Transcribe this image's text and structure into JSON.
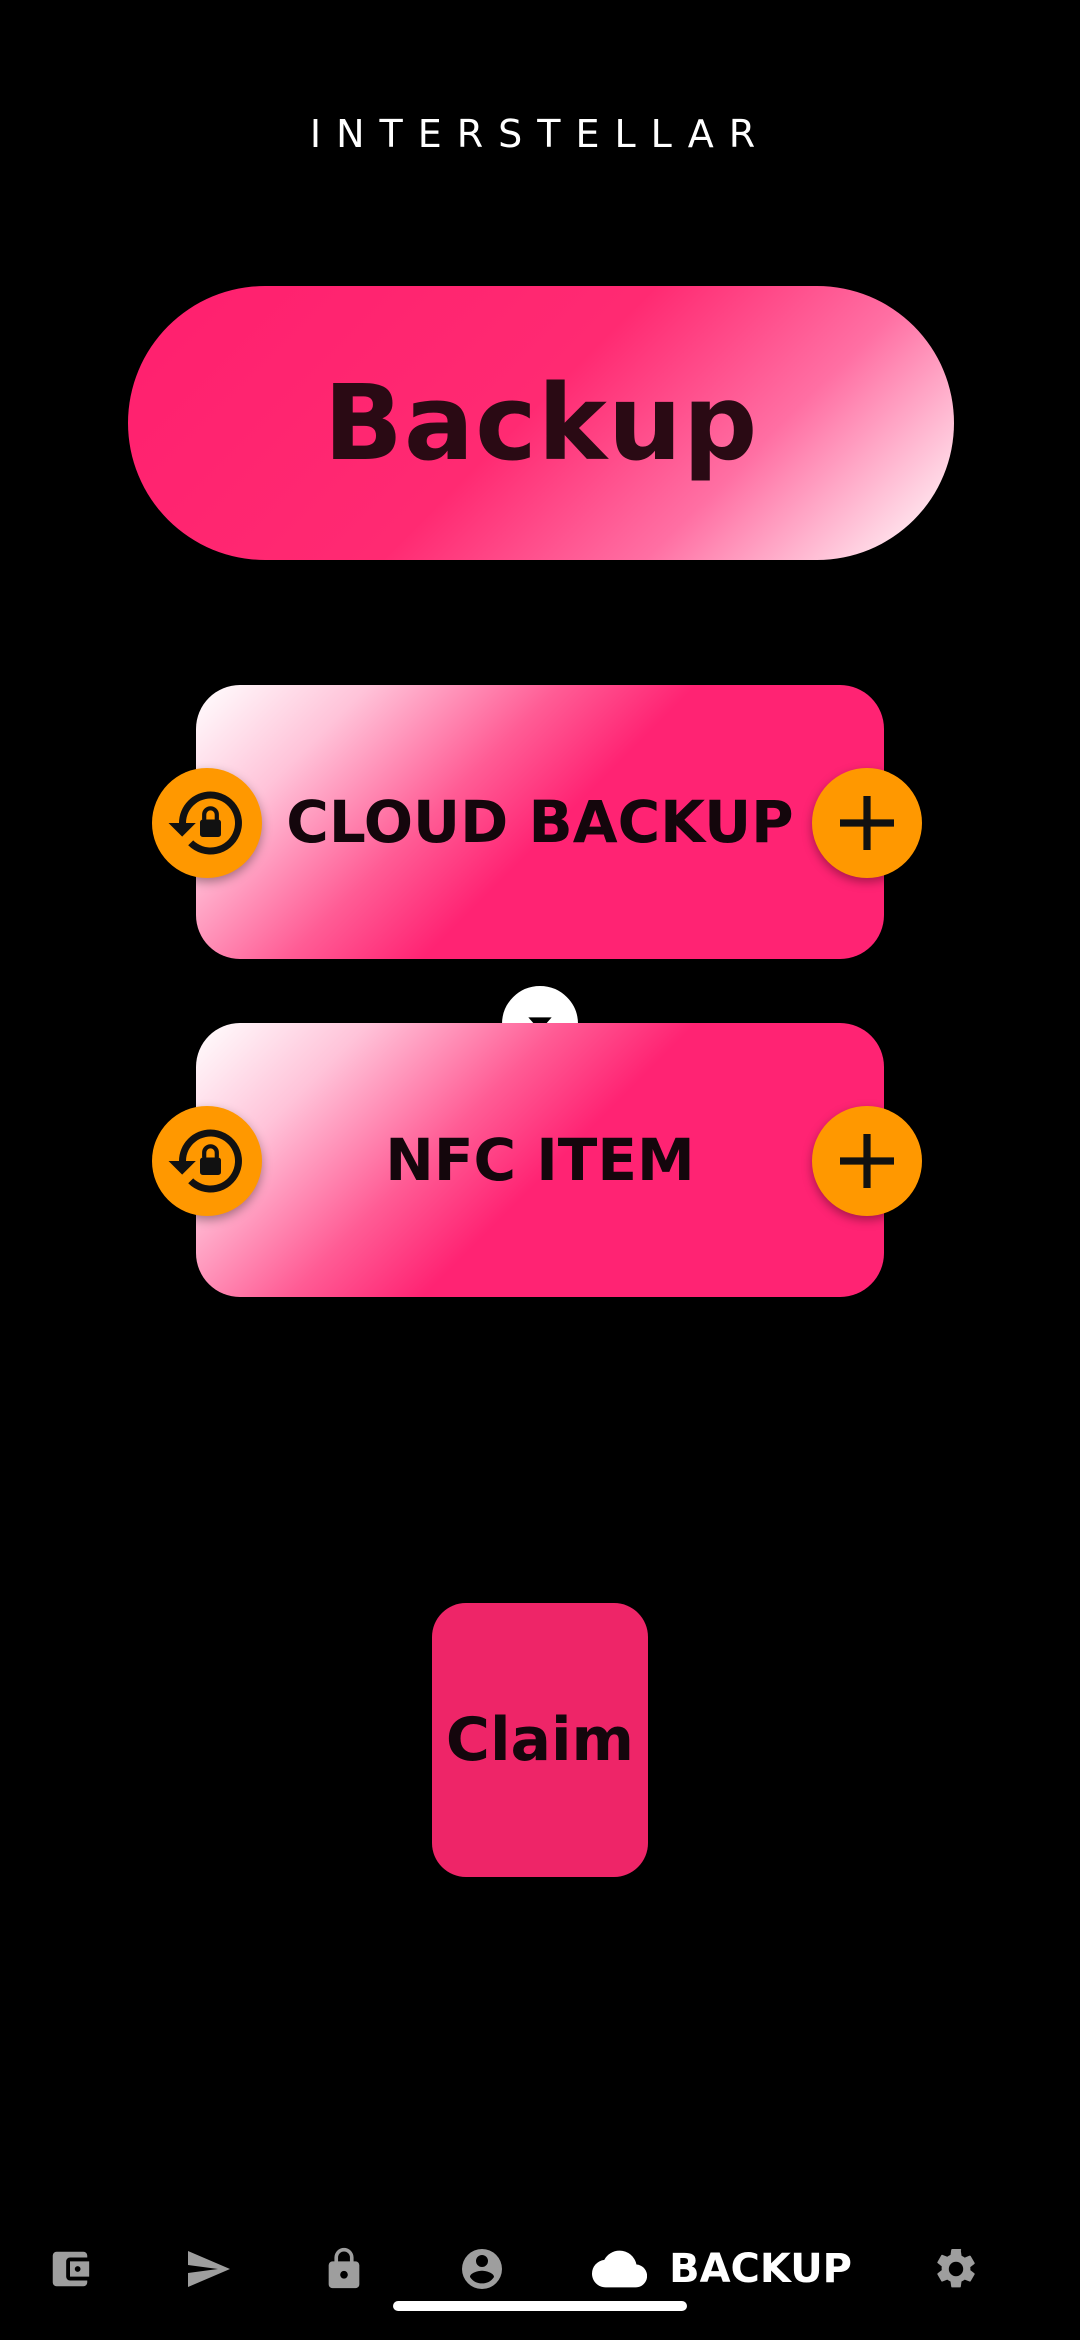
{
  "app": {
    "brand": "INTERSTELLAR"
  },
  "hero": {
    "title": "Backup"
  },
  "cards": {
    "cloud": {
      "label": "CLOUD BACKUP",
      "left_icon": "restore-lock-icon",
      "right_icon": "plus-icon"
    },
    "nfc": {
      "label": "NFC ITEM",
      "left_icon": "restore-lock-icon",
      "right_icon": "plus-icon"
    },
    "connector_icon": "chevron-down-icon"
  },
  "claim": {
    "label": "Claim"
  },
  "nav": {
    "items": [
      {
        "icon": "wallet-icon",
        "label": ""
      },
      {
        "icon": "send-icon",
        "label": ""
      },
      {
        "icon": "lock-icon",
        "label": ""
      },
      {
        "icon": "account-icon",
        "label": ""
      },
      {
        "icon": "cloud-icon",
        "label": "BACKUP",
        "active": true
      },
      {
        "icon": "settings-icon",
        "label": ""
      }
    ]
  },
  "colors": {
    "background": "#000000",
    "accent_pink": "#ff2373",
    "accent_orange": "#ff9800",
    "text_dark": "#14060c",
    "nav_inactive": "#9e9e9e",
    "nav_active": "#ffffff"
  }
}
